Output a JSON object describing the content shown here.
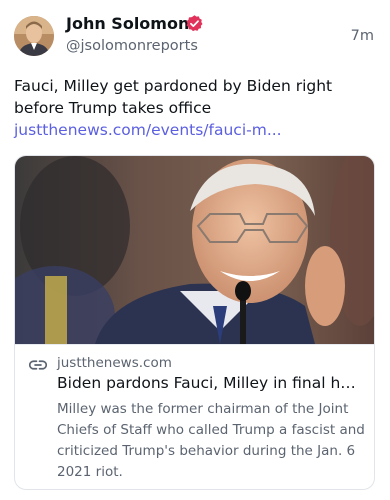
{
  "author": {
    "name": "John Solomon",
    "handle": "@jsolomonreports",
    "verified": true,
    "avatar_icon": "profile-photo"
  },
  "timestamp": "7m",
  "post": {
    "text": "Fauci, Milley get pardoned by Biden right before Trump takes office ",
    "link_text": "justthenews.com/events/fauci-m..."
  },
  "card": {
    "image": "photo-of-anthony-fauci-smiling",
    "domain": "justthenews.com",
    "title": "Biden pardons Fauci, Milley in final ho...",
    "description": "Milley was the former chairman of the Joint Chiefs of Staff who called Trump a fascist and criticized Trump's behavior during the Jan. 6 2021 riot."
  },
  "colors": {
    "link": "#5b5fe0",
    "verified_badge": "#e0325a",
    "muted_text": "#5b6470"
  }
}
